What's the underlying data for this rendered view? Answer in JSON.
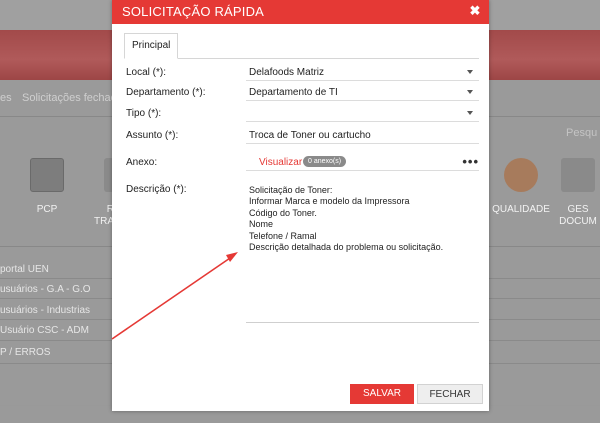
{
  "background": {
    "breadcrumb_left": "es",
    "breadcrumb_item": "Solicitações fechad",
    "search_text": "Pesqu",
    "tiles": [
      {
        "label": "PCP",
        "label2": ""
      },
      {
        "label": "R",
        "label2": "TRA"
      },
      {
        "label": "QUALIDADE",
        "label2": ""
      },
      {
        "label": "GES",
        "label2": "DOCUM"
      }
    ],
    "list_items": [
      "portal UEN",
      "usuários - G.A - G.O",
      "usuários - Industrias",
      "Usuário CSC - ADM",
      "P / ERROS"
    ]
  },
  "modal": {
    "title": "SOLICITAÇÃO RÁPIDA",
    "close_icon": "close-icon",
    "tab_label": "Principal",
    "fields": {
      "local": {
        "label": "Local (*):",
        "value": "Delafoods Matriz"
      },
      "departamento": {
        "label": "Departamento (*):",
        "value": "Departamento de TI"
      },
      "tipo": {
        "label": "Tipo (*):",
        "value": ""
      },
      "assunto": {
        "label": "Assunto (*):",
        "value": "Troca de Toner ou cartucho"
      },
      "anexo": {
        "label": "Anexo:",
        "link": "Visualizar",
        "badge": "0 anexo(s)",
        "more": "•••"
      },
      "descricao": {
        "label": "Descrição (*):",
        "value": "Solicitação de Toner:\nInformar Marca e modelo da Impressora\nCódigo do Toner.\nNome\nTelefone / Ramal\nDescrição detalhada do problema ou solicitação."
      }
    },
    "buttons": {
      "save": "SALVAR",
      "close": "FECHAR"
    },
    "colors": {
      "accent": "#e53935",
      "annotation_arrow": "#e53935"
    }
  }
}
